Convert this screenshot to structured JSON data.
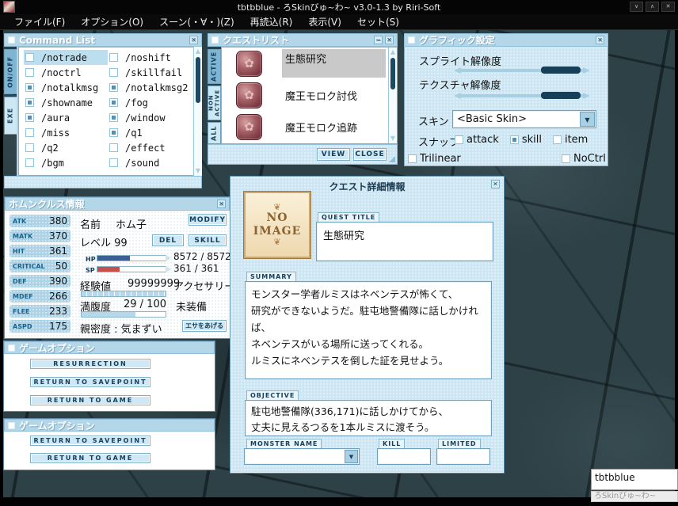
{
  "frame": {
    "title": "tbtbblue - ろSkinびゅ~わ~ v3.0-1.3 by Riri-Soft",
    "minimize_glyph": "∨",
    "maximize_glyph": "∧",
    "close_glyph": "✕"
  },
  "menubar": {
    "items": [
      "ファイル(F)",
      "オプション(O)",
      "スーン(・∀・)(Z)",
      "再読込(R)",
      "表示(V)",
      "セット(S)"
    ]
  },
  "icons": {
    "close": "✕",
    "minimize": "−",
    "dropdown": "▼",
    "scroll_up": "▲",
    "scroll_down": "▼",
    "quest": "✿"
  },
  "command_list": {
    "title": "Command List",
    "tabs": [
      {
        "label": "ON/OFF",
        "active": true
      },
      {
        "label": "EXE",
        "active": false
      }
    ],
    "items": [
      {
        "label": "/notrade",
        "checked": false,
        "selected": true
      },
      {
        "label": "/noshift",
        "checked": false
      },
      {
        "label": "/noctrl",
        "checked": false
      },
      {
        "label": "/skillfail",
        "checked": false
      },
      {
        "label": "/notalkmsg",
        "checked": true
      },
      {
        "label": "/notalkmsg2",
        "checked": true
      },
      {
        "label": "/showname",
        "checked": true
      },
      {
        "label": "/fog",
        "checked": true
      },
      {
        "label": "/aura",
        "checked": true
      },
      {
        "label": "/window",
        "checked": true
      },
      {
        "label": "/miss",
        "checked": false
      },
      {
        "label": "/q1",
        "checked": true
      },
      {
        "label": "/q2",
        "checked": false
      },
      {
        "label": "/effect",
        "checked": false
      },
      {
        "label": "/bgm",
        "checked": false
      },
      {
        "label": "/sound",
        "checked": false
      }
    ]
  },
  "quest_list": {
    "title": "クエストリスト",
    "tabs": [
      {
        "label": "ACTIVE",
        "active": true
      },
      {
        "label": "NON\nACTIVE",
        "active": false
      },
      {
        "label": "ALL",
        "active": false
      }
    ],
    "items": [
      {
        "label": "生態研究",
        "selected": true
      },
      {
        "label": "魔王モロク討伐",
        "selected": false
      },
      {
        "label": "魔王モロク追跡",
        "selected": false
      }
    ],
    "view_button": "VIEW",
    "close_button": "CLOSE"
  },
  "graphics": {
    "title": "グラフィック設定",
    "sliders": [
      {
        "label": "スプライト解像度"
      },
      {
        "label": "テクスチャ解像度"
      }
    ],
    "skin_label": "スキン",
    "skin_value": "<Basic Skin>",
    "snap_label": "スナップ",
    "snap_options": [
      {
        "label": "attack",
        "checked": false
      },
      {
        "label": "skill",
        "checked": true
      },
      {
        "label": "item",
        "checked": false
      }
    ],
    "trilinear": {
      "label": "Trilinear",
      "checked": false
    },
    "noctrl": {
      "label": "NoCtrl",
      "checked": false
    }
  },
  "homunculus": {
    "title": "ホムンクルス情報",
    "stats": [
      {
        "label": "ATK",
        "value": "380"
      },
      {
        "label": "MATK",
        "value": "370"
      },
      {
        "label": "HIT",
        "value": "361"
      },
      {
        "label": "CRITICAL",
        "value": "50"
      },
      {
        "label": "DEF",
        "value": "390"
      },
      {
        "label": "MDEF",
        "value": "266"
      },
      {
        "label": "FLEE",
        "value": "233"
      },
      {
        "label": "ASPD",
        "value": "175"
      }
    ],
    "name_label": "名前",
    "name_value": "ホム子",
    "modify_button": "MODIFY",
    "level_text": "レベル 99",
    "del_button": "DEL",
    "skill_button": "SKILL",
    "hp_label": "HP",
    "hp_text": "8572 / 8572",
    "hp_percent": 48,
    "sp_label": "SP",
    "sp_text": "361 / 361",
    "sp_percent": 33,
    "exp_label": "経験値",
    "exp_value": "99999999",
    "exp_percent": 100,
    "accessory_label": "アクセサリー",
    "satiety_label": "満腹度",
    "satiety_value": "29 / 100",
    "satiety_percent": 64,
    "unequipped": "未装備",
    "intimacy_text": "親密度 : 気まずい",
    "feed_button": "エサをあげる"
  },
  "quest_detail": {
    "title": "クエスト詳細情報",
    "no_image_line1": "NO",
    "no_image_line2": "IMAGE",
    "ornament": "❦",
    "quest_title_label": "QUEST TITLE",
    "quest_title": "生態研究",
    "summary_label": "SUMMARY",
    "summary": "モンスター学者ルミスはネベンテスが怖くて、\n研究ができないようだ。駐屯地警備隊に話しかければ、\nネベンテスがいる場所に送ってくれる。\nルミスにネベンテスを倒した証を見せよう。",
    "objective_label": "OBJECTIVE",
    "objective": "駐屯地警備隊(336,171)に話しかけてから、\n丈夫に見えるつるを1本ルミスに渡そう。",
    "monster_label": "MONSTER NAME",
    "kill_label": "KILL",
    "limited_label": "LIMITED"
  },
  "game_options1": {
    "title": "ゲームオプション",
    "buttons": [
      "RESURRECTION",
      "RETURN TO SAVEPOINT",
      "RETURN TO GAME"
    ]
  },
  "game_options2": {
    "title": "ゲームオプション",
    "buttons": [
      "RETURN TO SAVEPOINT",
      "RETURN TO GAME"
    ]
  },
  "taskbar": {
    "name": "tbtbblue",
    "app": "ろSkinびゅ~わ~"
  },
  "colors": {
    "titlebar_blue": "#b3d7e9",
    "panel_blue": "#cde6f3",
    "accent_navy": "#16405c",
    "hp_fill": "#3c5e97",
    "sp_fill": "#c4504e",
    "selected_gray": "#c9c9c9"
  }
}
